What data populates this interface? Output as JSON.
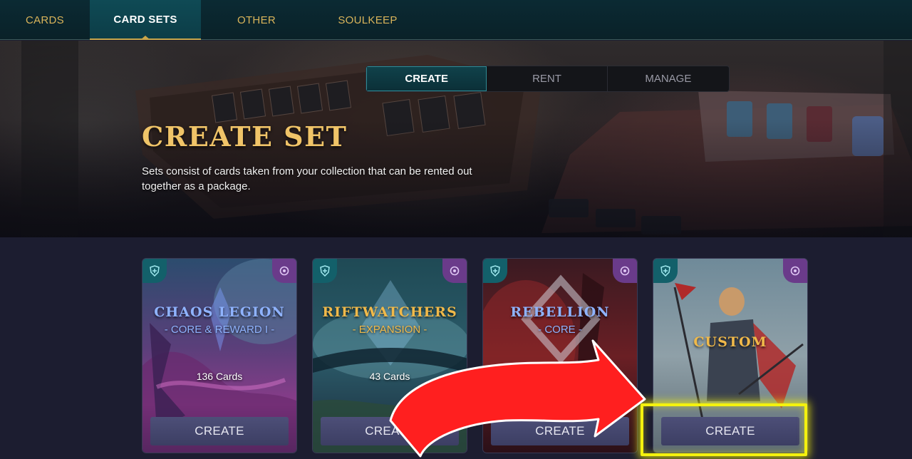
{
  "nav": {
    "tabs": [
      {
        "label": "CARDS"
      },
      {
        "label": "CARD SETS",
        "active": true
      },
      {
        "label": "OTHER"
      },
      {
        "label": "SOULKEEP"
      }
    ]
  },
  "hero": {
    "segments": [
      {
        "label": "CREATE",
        "active": true
      },
      {
        "label": "RENT"
      },
      {
        "label": "MANAGE"
      }
    ],
    "title": "CREATE SET",
    "description": "Sets consist of cards taken from your collection that can be rented out together as a package."
  },
  "cards": [
    {
      "name": "CHAOS LEGION",
      "subtitle": "- CORE & REWARD I -",
      "count": "136 Cards",
      "button": "CREATE",
      "accent": "#8fb3ff"
    },
    {
      "name": "RIFTWATCHERS",
      "subtitle": "- EXPANSION -",
      "count": "43 Cards",
      "button": "CREATE",
      "accent": "#f0b94a"
    },
    {
      "name": "REBELLION",
      "subtitle": "- CORE -",
      "count": "",
      "button": "CREATE",
      "accent": "#8fb3ff"
    },
    {
      "name": "CUSTOM",
      "subtitle": "",
      "count": "",
      "button": "CREATE",
      "accent": "#f0b94a"
    }
  ],
  "annotation": {
    "arrow_color": "#ff1f1f",
    "highlight_color": "#f4f20e"
  }
}
